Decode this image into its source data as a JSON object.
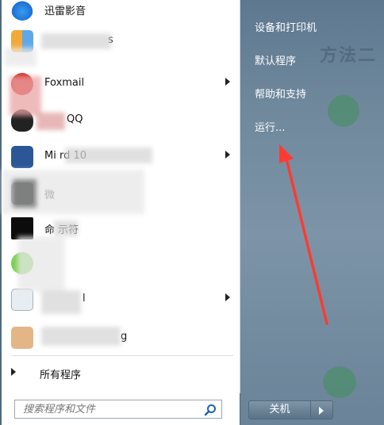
{
  "right_menu": {
    "items": [
      {
        "label": "设备和打印机"
      },
      {
        "label": "默认程序"
      },
      {
        "label": "帮助和支持"
      },
      {
        "label": "运行..."
      }
    ],
    "background_text": "方法二"
  },
  "programs": [
    {
      "label": "迅雷影音",
      "icon": "xunlei-icon",
      "has_submenu": false
    },
    {
      "label": "s",
      "icon": "app-icon",
      "has_submenu": false
    },
    {
      "label": "Foxmail",
      "icon": "foxmail-icon",
      "has_submenu": true
    },
    {
      "label": "QQ",
      "icon": "qq-penguin-icon",
      "has_submenu": false
    },
    {
      "label": "Mi         rd   10",
      "icon": "word-icon",
      "has_submenu": true
    },
    {
      "label": "微",
      "icon": "wechat-icon",
      "has_submenu": false
    },
    {
      "label": "命      示符",
      "icon": "cmd-icon",
      "has_submenu": false
    },
    {
      "label": "",
      "icon": "wechat-green-icon",
      "has_submenu": false
    },
    {
      "label": "l",
      "icon": "paint-icon",
      "has_submenu": true
    },
    {
      "label": "g",
      "icon": "notepad-icon",
      "has_submenu": false
    }
  ],
  "all_programs": {
    "label": "所有程序"
  },
  "search": {
    "placeholder": "搜索程序和文件",
    "value": ""
  },
  "shutdown": {
    "label": "关机"
  },
  "colors": {
    "annotation_arrow": "#ff3b30",
    "right_pane": "#6f889c"
  }
}
